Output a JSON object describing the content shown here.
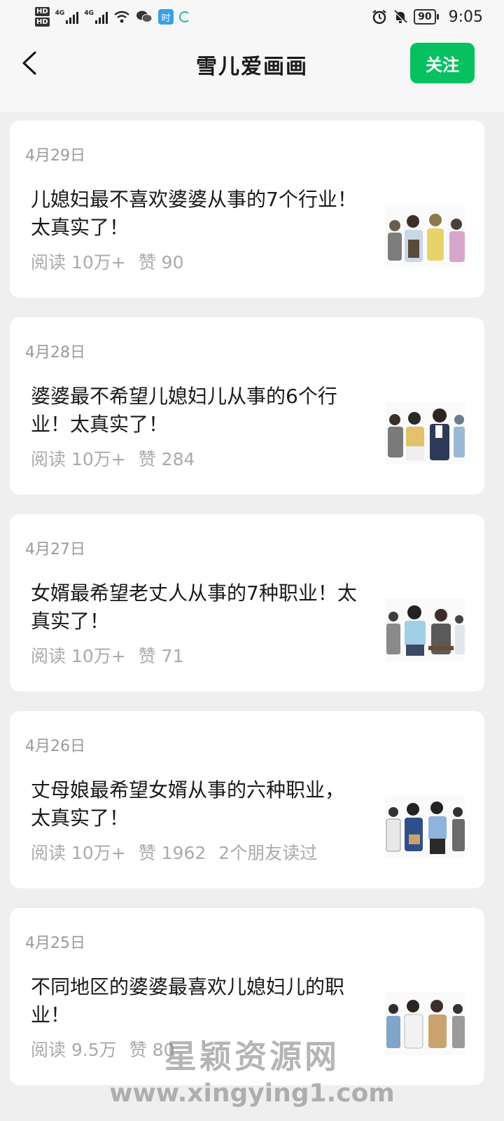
{
  "status_bar": {
    "hd1": "HD",
    "hd2": "HD",
    "net1": "4G",
    "net2": "4G",
    "app_badge": "时",
    "battery": "90",
    "time": "9:05"
  },
  "header": {
    "title": "雪儿爱画画",
    "follow_label": "关注",
    "accent_color": "#07c160"
  },
  "articles": [
    {
      "date": "4月29日",
      "title": "儿媳妇最不喜欢婆婆从事的7个行业！太真实了！",
      "reads": "阅读 10万+",
      "likes": "赞 90",
      "friends": ""
    },
    {
      "date": "4月28日",
      "title": "婆婆最不希望儿媳妇儿从事的6个行业！太真实了！",
      "reads": "阅读 10万+",
      "likes": "赞 284",
      "friends": ""
    },
    {
      "date": "4月27日",
      "title": "女婿最希望老丈人从事的7种职业！太真实了！",
      "reads": "阅读 10万+",
      "likes": "赞 71",
      "friends": ""
    },
    {
      "date": "4月26日",
      "title": "丈母娘最希望女婿从事的六种职业，太真实了！",
      "reads": "阅读 10万+",
      "likes": "赞 1962",
      "friends": "2个朋友读过"
    },
    {
      "date": "4月25日",
      "title": "不同地区的婆婆最喜欢儿媳妇儿的职业！",
      "reads": "阅读 9.5万",
      "likes": "赞 80",
      "friends": ""
    }
  ],
  "watermark": {
    "cn": "星颖资源网",
    "en": "www.xingying1.com"
  }
}
